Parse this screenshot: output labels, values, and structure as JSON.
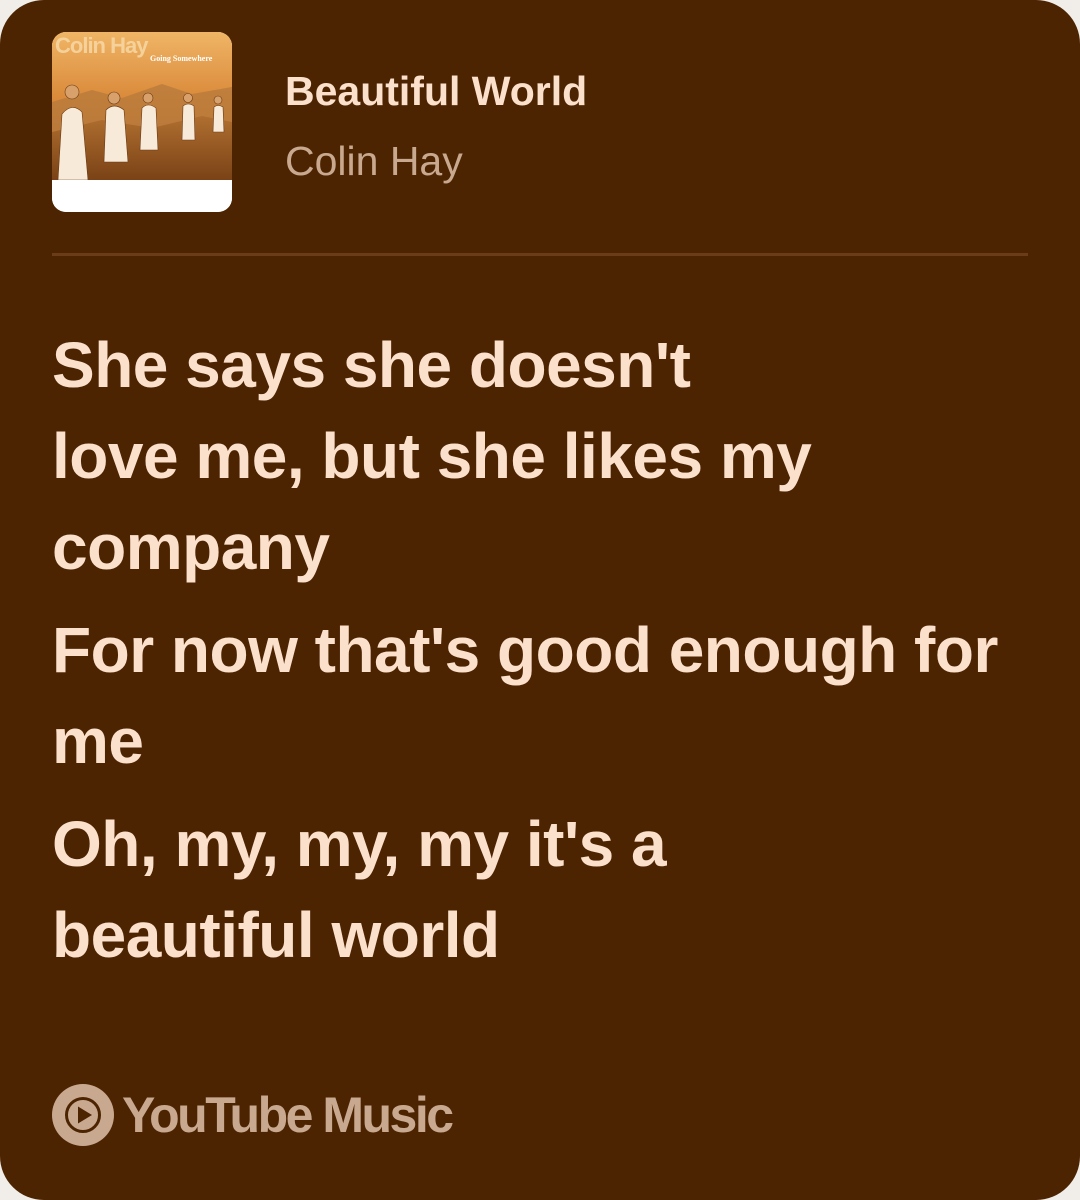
{
  "song": {
    "title": "Beautiful World",
    "artist": "Colin Hay"
  },
  "album_art": {
    "artist_text": "Colin Hay",
    "album_text": "Going Somewhere"
  },
  "lyrics": [
    "She says she doesn't love me, but she likes my company",
    "For now that's good enough for me",
    "Oh, my, my, my it's a beautiful world"
  ],
  "footer": {
    "brand": "YouTube Music",
    "icon": "youtube-music-icon"
  },
  "colors": {
    "background": "#4d2402",
    "text_primary": "#fbe0cc",
    "text_secondary": "#c8a98f",
    "divider": "#6a3c18"
  }
}
